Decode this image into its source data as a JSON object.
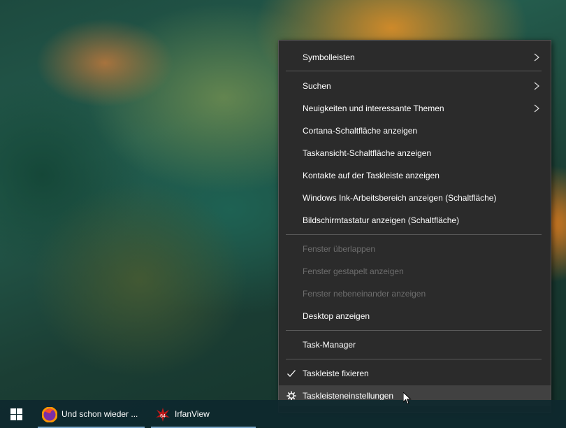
{
  "menu": {
    "items": [
      {
        "label": "Symbolleisten",
        "submenu": true,
        "enabled": true
      },
      {
        "label": "Suchen",
        "submenu": true,
        "enabled": true
      },
      {
        "label": "Neuigkeiten und interessante Themen",
        "submenu": true,
        "enabled": true
      },
      {
        "label": "Cortana-Schaltfläche anzeigen",
        "enabled": true
      },
      {
        "label": "Taskansicht-Schaltfläche anzeigen",
        "enabled": true
      },
      {
        "label": "Kontakte auf der Taskleiste anzeigen",
        "enabled": true
      },
      {
        "label": "Windows Ink-Arbeitsbereich anzeigen (Schaltfläche)",
        "enabled": true
      },
      {
        "label": "Bildschirmtastatur anzeigen (Schaltfläche)",
        "enabled": true
      },
      {
        "label": "Fenster überlappen",
        "enabled": false
      },
      {
        "label": "Fenster gestapelt anzeigen",
        "enabled": false
      },
      {
        "label": "Fenster nebeneinander anzeigen",
        "enabled": false
      },
      {
        "label": "Desktop anzeigen",
        "enabled": true
      },
      {
        "label": "Task-Manager",
        "enabled": true
      },
      {
        "label": "Taskleiste fixieren",
        "enabled": true,
        "checked": true,
        "icon": "checkmark-icon"
      },
      {
        "label": "Taskleisteneinstellungen",
        "enabled": true,
        "icon": "gear-icon",
        "hovered": true
      }
    ]
  },
  "taskbar": {
    "apps": [
      {
        "label": "Und schon wieder ...",
        "icon": "firefox-icon"
      },
      {
        "label": "IrfanView",
        "icon": "irfanview-icon",
        "badge": "64"
      }
    ]
  },
  "colors": {
    "menu_bg": "#2b2b2b",
    "menu_text": "#ffffff",
    "menu_disabled": "#6d6d6d",
    "hover_bg": "#414141",
    "taskbar_bg": "#0e282e",
    "accent_underline": "#7aa7c9"
  }
}
